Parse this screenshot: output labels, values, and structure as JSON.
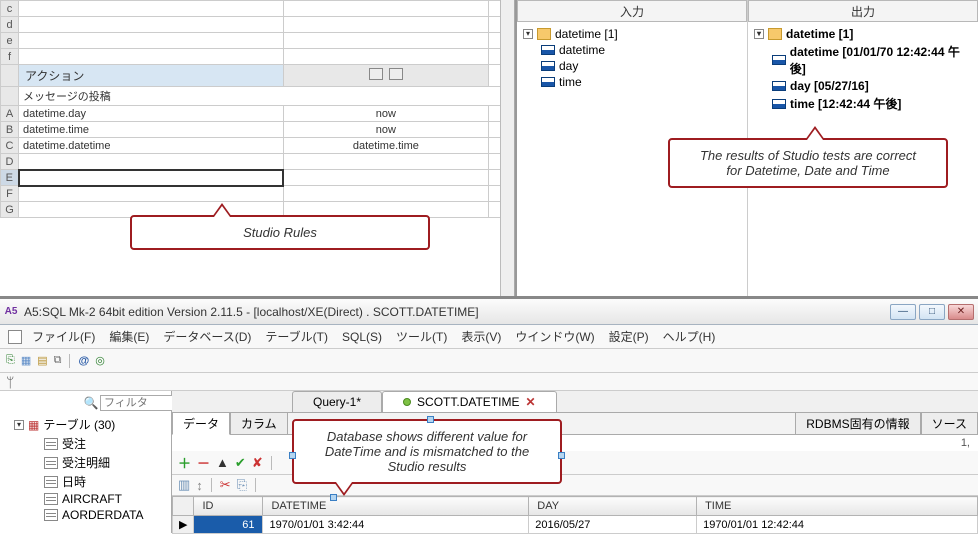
{
  "sheet": {
    "rows_top": [
      "c",
      "d",
      "e",
      "f"
    ],
    "action_header": "アクション",
    "message_post": "メッセージの投稿",
    "rules": [
      {
        "row": "A",
        "col1": "datetime.day",
        "col2": "now"
      },
      {
        "row": "B",
        "col1": "datetime.time",
        "col2": "now"
      },
      {
        "row": "C",
        "col1": "datetime.datetime",
        "col2": "datetime.time"
      }
    ],
    "empty_rows": [
      "D",
      "E",
      "F",
      "G"
    ]
  },
  "tree": {
    "input_header": "入力",
    "output_header": "出力",
    "input": {
      "root": "datetime [1]",
      "items": [
        "datetime",
        "day",
        "time"
      ]
    },
    "output": {
      "root": "datetime [1]",
      "items": [
        "datetime [01/01/70 12:42:44 午後]",
        "day [05/27/16]",
        "time [12:42:44 午後]"
      ]
    }
  },
  "callouts": {
    "rules": "Studio Rules",
    "results_l1": "The results of Studio tests are correct",
    "results_l2": "for Datetime, Date and Time",
    "db_l1": "Database shows different value for",
    "db_l2": "DateTime and is mismatched to the",
    "db_l3": "Studio results"
  },
  "app": {
    "title": "A5:SQL Mk-2 64bit edition Version 2.11.5 - [localhost/XE(Direct) . SCOTT.DATETIME]",
    "icon_text": "A5",
    "menu": [
      "ファイル(F)",
      "編集(E)",
      "データベース(D)",
      "テーブル(T)",
      "SQL(S)",
      "ツール(T)",
      "表示(V)",
      "ウインドウ(W)",
      "設定(P)",
      "ヘルプ(H)"
    ],
    "filter_placeholder": "フィルタ",
    "tables_label": "テーブル (30)",
    "table_list": [
      "受注",
      "受注明細",
      "日時",
      "AIRCRAFT",
      "AORDERDATA"
    ],
    "tabs": {
      "query": "Query-1*",
      "data": "SCOTT.DATETIME"
    },
    "subtabs": [
      "データ",
      "カラム",
      "RDBMS固有の情報",
      "ソース"
    ],
    "count_label": "1,",
    "grid": {
      "headers": [
        "ID",
        "DATETIME",
        "DAY",
        "TIME"
      ],
      "row": {
        "id": "61",
        "datetime": "1970/01/01 3:42:44",
        "day": "2016/05/27",
        "time": "1970/01/01 12:42:44"
      }
    }
  }
}
